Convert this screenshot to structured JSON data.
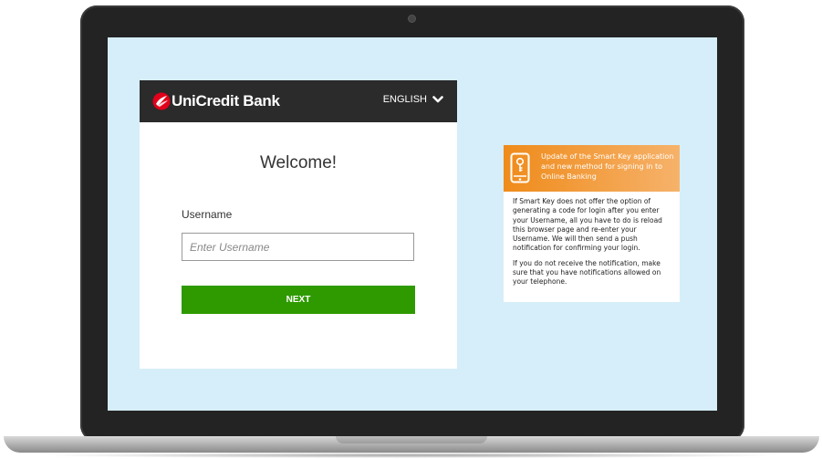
{
  "header": {
    "brand_name": "UniCredit Bank",
    "language_label": "ENGLISH"
  },
  "login": {
    "welcome_title": "Welcome!",
    "username_label": "Username",
    "username_placeholder": "Enter Username",
    "username_value": "",
    "next_label": "NEXT"
  },
  "info_panel": {
    "title": "Update of the Smart Key application and new method for signing in to Online Banking",
    "paragraph_1": "If Smart Key does not offer the option of generating a code for login after you enter your Username, all you have to do is reload this browser page and re-enter your Username. We will then send a push notification for confirming your login.",
    "paragraph_2": "If you do not receive the notification, make sure that you have notifications allowed on your telephone."
  },
  "icons": {
    "logo": "unicredit-logo-icon",
    "language_chevron": "chevron-down-icon",
    "info": "phone-key-icon"
  },
  "colors": {
    "brand_red": "#e2001a",
    "header_bg": "#2b2b2b",
    "primary_button": "#2e9a00",
    "info_header": "#ef8b1b",
    "screen_bg": "#d6eef9"
  }
}
